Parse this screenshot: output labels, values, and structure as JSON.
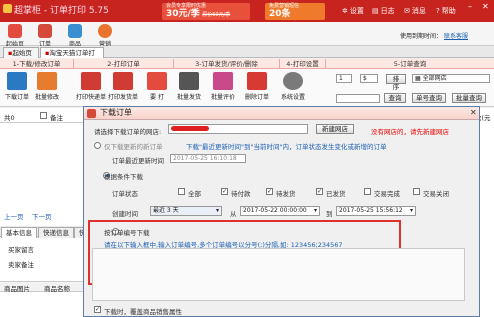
{
  "app": {
    "title": "超掌柜 - 订单打印 5.75"
  },
  "banners": [
    {
      "top": "会员专享限时优惠",
      "price": "30元/季",
      "old": "原价60元/季"
    },
    {
      "top": "免费营销短信",
      "price": "20条"
    }
  ],
  "titlebar": {
    "settings": "设置",
    "log": "日志",
    "message": "消息",
    "help": "帮助"
  },
  "account": {
    "expiry": "使用到期时间：",
    "contact": "联系客服"
  },
  "nav": {
    "items": [
      "起始页",
      "订单",
      "商品",
      "营销"
    ]
  },
  "tabs": [
    "起始页",
    "淘宝天猫订单打印"
  ],
  "groups": [
    "1-下载/修改订单",
    "2-打印订单",
    "3-订单发货/评价/删除",
    "4-打印设置",
    "5-订单查询"
  ],
  "tools": [
    "下载订单",
    "批量修改",
    "打印快递单",
    "打印发货单",
    "要 打",
    "批量发货",
    "批量评价",
    "删除订单",
    "系统设置"
  ],
  "query": {
    "sel1": "1",
    "sel2": "$",
    "order_btn": "排序",
    "shop": "全部网店",
    "query_btn": "查询",
    "range_btn": "单号查询",
    "exact_btn": "批量查询"
  },
  "left": {
    "count_label": "共0",
    "remark_label": "备注",
    "prev": "上一页",
    "next": "下一页",
    "tabs": [
      "基本信息",
      "快递信息",
      "快"
    ],
    "fields": [
      "买家留言",
      "卖家备注"
    ],
    "grid_cols": [
      "商品图片",
      "商品名称"
    ]
  },
  "right": {
    "col": "实收款(元"
  },
  "dialog": {
    "title": "下载订单",
    "shop_label": "请选择下载订单的网店:",
    "new_shop": "新建网店",
    "no_shop_tip": "没有网店的，请先新建网店",
    "opt1": "仅下载更新的新订单",
    "opt1_tip": "下载\"最近更新时间\"到\"当前时间\"内，订单状态发生变化或新增的订单",
    "last_update_label": "订单最近更新时间",
    "last_update_value": "2017-05-25 16:10:18",
    "opt2": "根据条件下载",
    "status_label": "订单状态",
    "statuses": [
      "全部",
      "待付款",
      "待发货",
      "已发货",
      "交易完成",
      "交易关闭"
    ],
    "created_label": "创建时间",
    "created_preset": "最近 3 天",
    "from_label": "从",
    "from_value": "2017-05-22 00:00:00",
    "to_label": "到",
    "to_value": "2017-05-25 15:56:12",
    "opt3": "按订单编号下载",
    "order_no_tip": "请在以下输入框中,输入订单编号,多个订单编号以分号(;)分隔,如: 123456;234567",
    "footer_chk": "下载时，覆盖商品销售属性"
  }
}
